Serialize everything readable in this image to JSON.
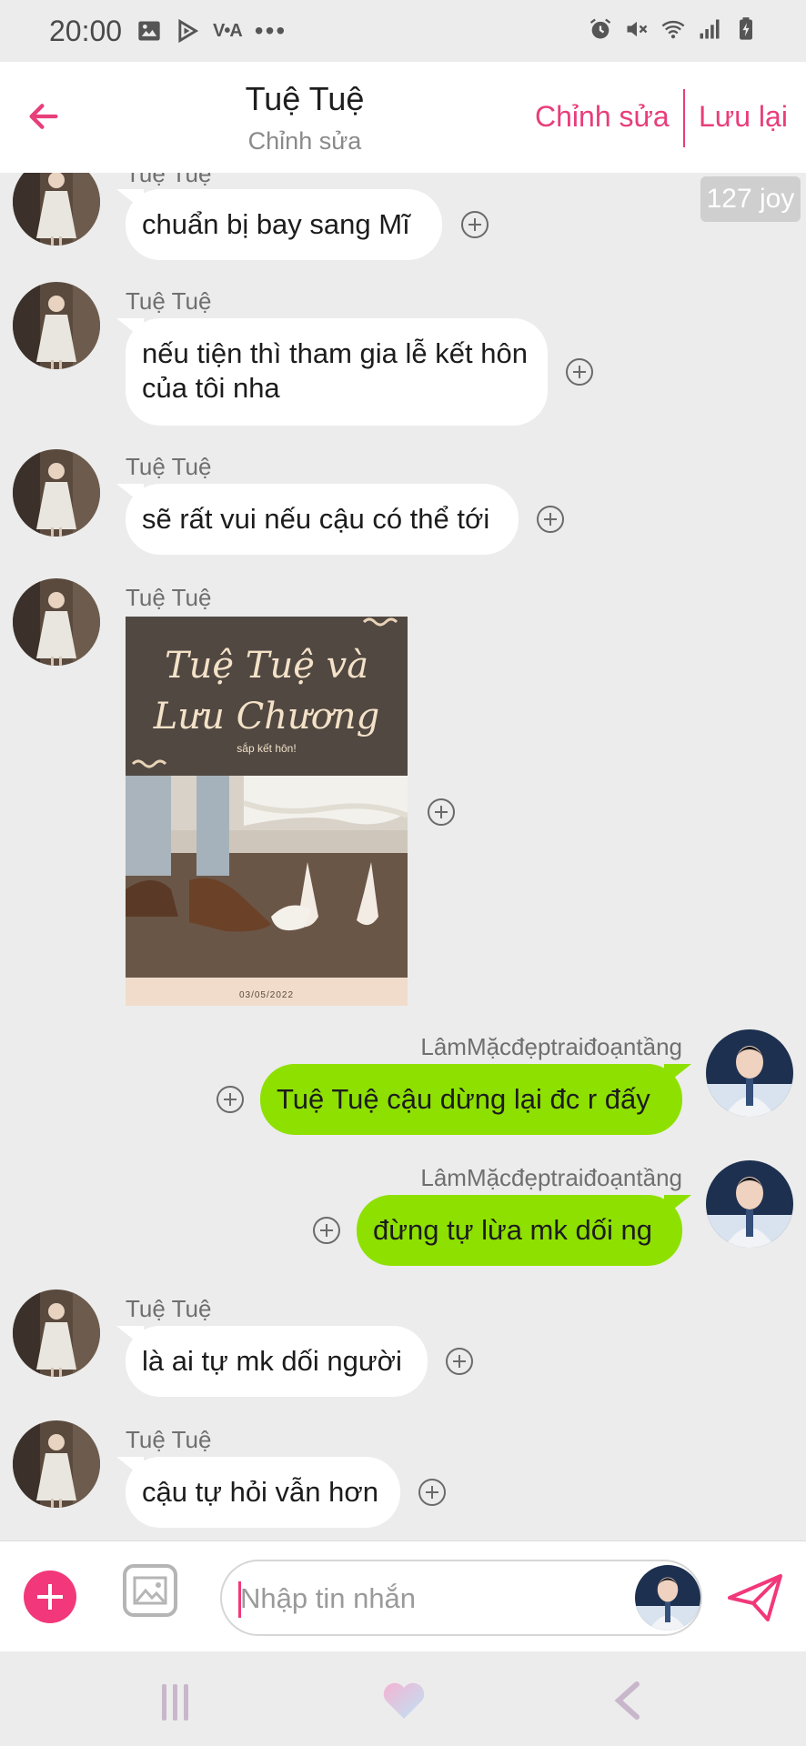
{
  "status_bar": {
    "time": "20:00",
    "carrier_badge": "V•A",
    "more": "•••",
    "left_icons": [
      "image-icon",
      "play-icon",
      "vietnamese-carrier-icon",
      "more-icon"
    ],
    "right_icons": [
      "alarm-icon",
      "mute-icon",
      "wifi-icon",
      "signal-icon",
      "battery-charging-icon"
    ]
  },
  "header": {
    "title": "Tuệ Tuệ",
    "subtitle": "Chỉnh sửa",
    "edit_label": "Chỉnh sửa",
    "save_label": "Lưu lại"
  },
  "joy_badge": "127 joy",
  "messages": [
    {
      "sender": "Tuệ Tuệ",
      "side": "left",
      "text": "chuẩn bị bay sang Mĩ"
    },
    {
      "sender": "Tuệ Tuệ",
      "side": "left",
      "text": "nếu tiện thì tham gia lễ kết hôn của tôi nha"
    },
    {
      "sender": "Tuệ Tuệ",
      "side": "left",
      "text": "sẽ rất vui nếu cậu có thể tới"
    },
    {
      "sender": "Tuệ Tuệ",
      "side": "left",
      "type": "image",
      "card": {
        "title_line1": "Tuệ Tuệ và",
        "title_line2": "Lưu Chương",
        "subtitle": "sắp kết hôn!",
        "date": "03/05/2022"
      }
    },
    {
      "sender": "LâmMặcđẹptraiđoạntầng",
      "side": "right",
      "text": "Tuệ Tuệ cậu dừng lại đc r đấy"
    },
    {
      "sender": "LâmMặcđẹptraiđoạntầng",
      "side": "right",
      "text": "đừng tự lừa mk dối ng"
    },
    {
      "sender": "Tuệ Tuệ",
      "side": "left",
      "text": "là ai tự mk dối người"
    },
    {
      "sender": "Tuệ Tuệ",
      "side": "left",
      "text": "cậu tự hỏi vẫn hơn"
    }
  ],
  "input_bar": {
    "placeholder": "Nhập tin nhắn",
    "value": ""
  },
  "colors": {
    "accent": "#e83e7a",
    "own_bubble": "#8ee000",
    "other_bubble": "#ffffff",
    "background": "#ececec"
  }
}
